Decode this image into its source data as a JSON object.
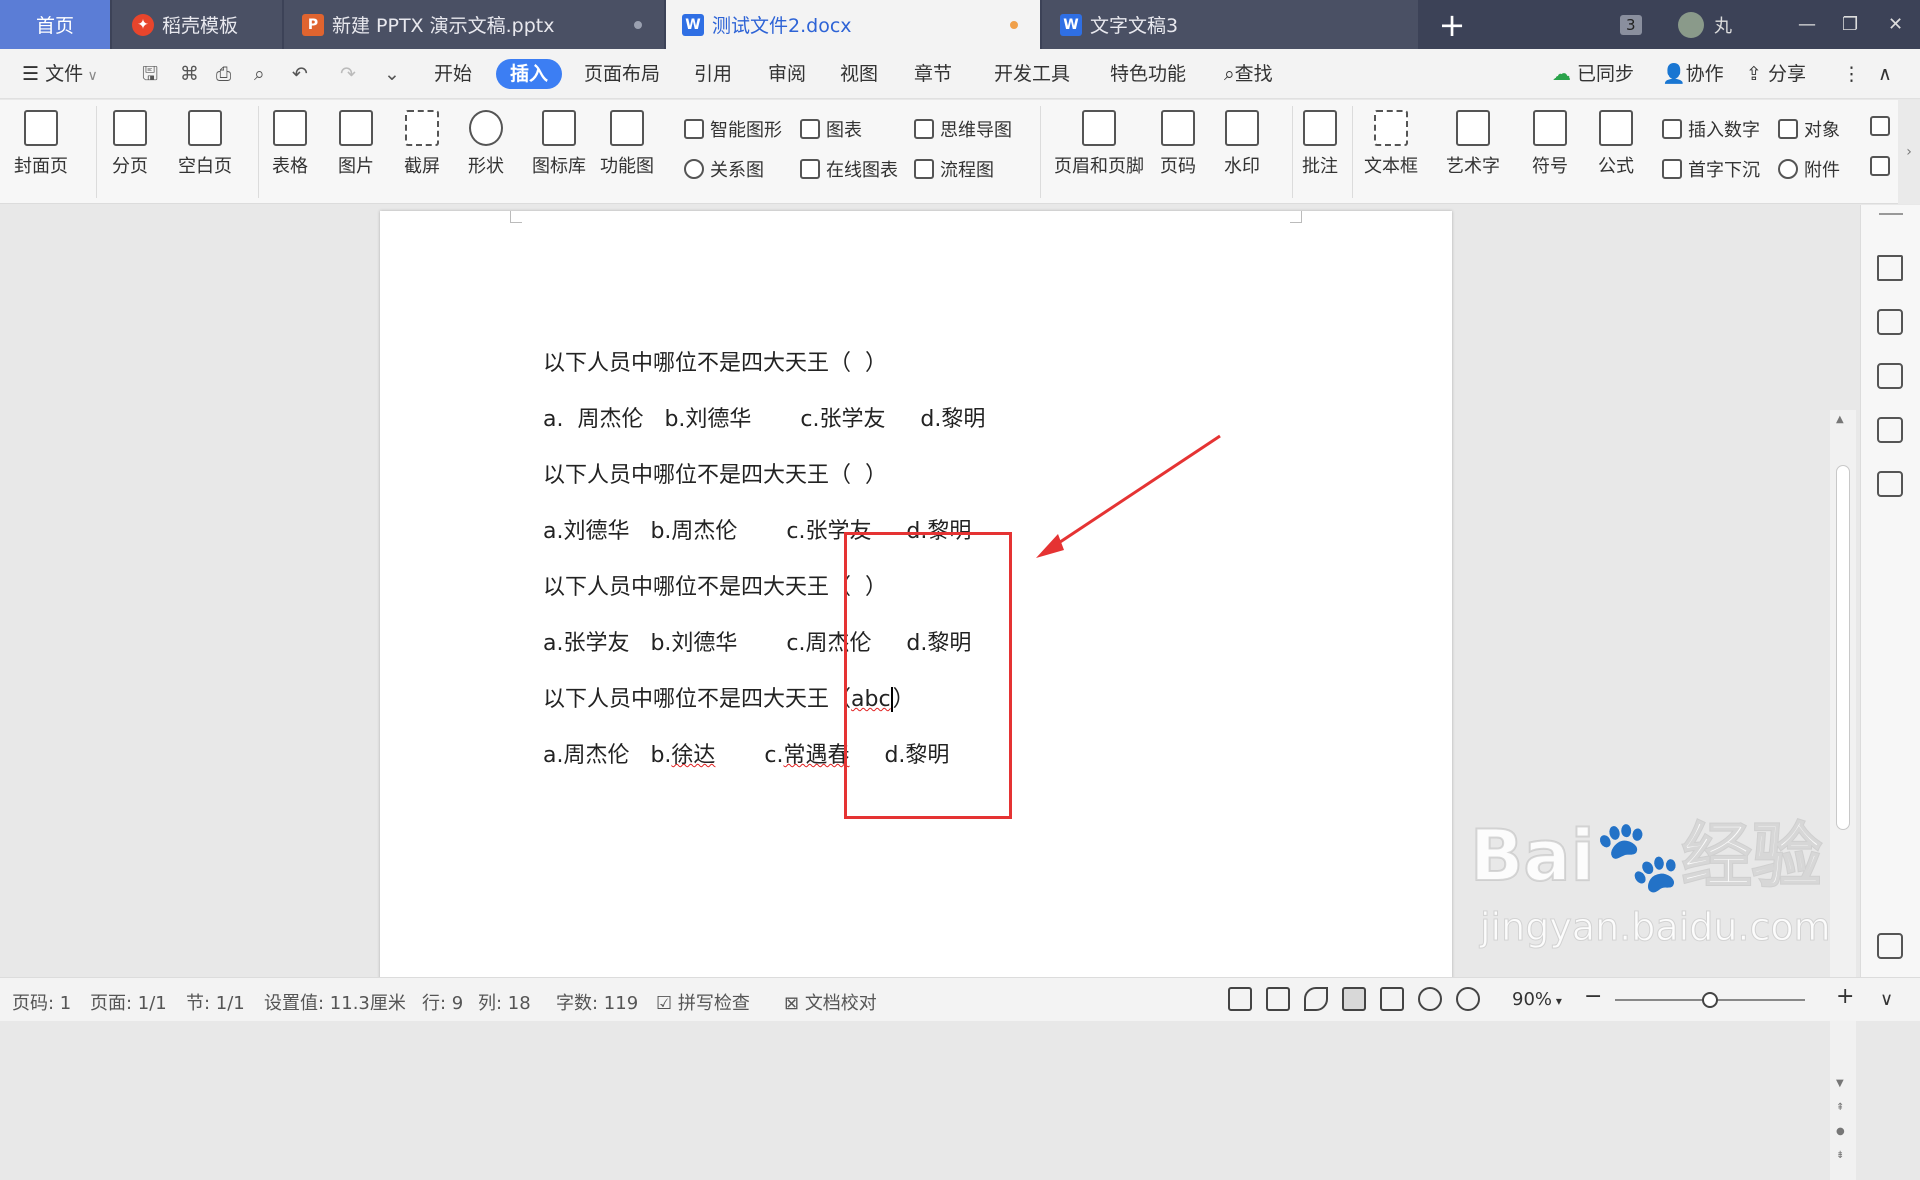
{
  "tabs": {
    "home": "首页",
    "daoke": "稻壳模板",
    "pptx": "新建 PPTX 演示文稿.pptx",
    "docx": "测试文件2.docx",
    "doc3": "文字文稿3",
    "add": "+",
    "count": "3",
    "user": "丸"
  },
  "menu": {
    "file": "文件",
    "items": [
      "开始",
      "插入",
      "页面布局",
      "引用",
      "审阅",
      "视图",
      "章节",
      "开发工具",
      "特色功能"
    ],
    "search": "查找",
    "synced": "已同步",
    "collab": "协作",
    "share": "分享"
  },
  "ribbon": {
    "cover": "封面页",
    "pagebreak": "分页",
    "blankpage": "空白页",
    "table": "表格",
    "picture": "图片",
    "screenshot": "截屏",
    "shape": "形状",
    "iconlib": "图标库",
    "funcchart": "功能图",
    "smartart": "智能图形",
    "chart": "图表",
    "mindmap": "思维导图",
    "relation": "关系图",
    "onlinechart": "在线图表",
    "flowchart": "流程图",
    "headerfooter": "页眉和页脚",
    "pagenum": "页码",
    "watermark": "水印",
    "comment": "批注",
    "textbox": "文本框",
    "arttext": "艺术字",
    "symbol": "符号",
    "formula": "公式",
    "insertnum": "插入数字",
    "object": "对象",
    "dropcap": "首字下沉",
    "attach": "附件"
  },
  "document": {
    "lines": [
      "以下人员中哪位不是四大天王（  ）",
      "a.  周杰伦   b.刘德华       c.张学友     d.黎明",
      "以下人员中哪位不是四大天王（  ）",
      "a.刘德华   b.周杰伦       c.张学友     d.黎明",
      "以下人员中哪位不是四大天王（  ）",
      "a.张学友   b.刘德华       c.周杰伦     d.黎明"
    ],
    "line7_prefix": "以下人员中哪位不是四大天王（",
    "line7_typed": "abc",
    "line7_suffix": "）",
    "line8_a": "a.周杰伦   b.",
    "line8_b": "徐达",
    "line8_c": "       c.",
    "line8_d": "常遇春",
    "line8_e": "     d.黎明"
  },
  "status": {
    "page": "页码: 1",
    "pages": "页面: 1/1",
    "section": "节: 1/1",
    "setting": "设置值: 11.3厘米",
    "row": "行: 9",
    "col": "列: 18",
    "words": "字数: 119",
    "spell": "拼写检查",
    "proof": "文档校对",
    "zoom": "90%",
    "zoom_level": 0.5
  },
  "watermark": {
    "brand": "Bai",
    "brand2": "经验",
    "url": "jingyan.baidu.com"
  },
  "colors": {
    "accent": "#3c7ef3",
    "highlight_box": "#e53333",
    "tabbar": "#3c4257"
  }
}
